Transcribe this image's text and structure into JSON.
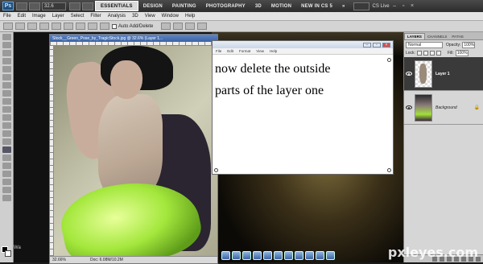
{
  "appbar": {
    "logo": "Ps",
    "zoom": "32.6",
    "workspaces": [
      "ESSENTIALS",
      "DESIGN",
      "PAINTING",
      "PHOTOGRAPHY",
      "3D",
      "MOTION",
      "NEW IN CS 5"
    ],
    "active_workspace": "ESSENTIALS",
    "cs_live": "CS Live"
  },
  "menubar": {
    "items": [
      "File",
      "Edit",
      "Image",
      "Layer",
      "Select",
      "Filter",
      "Analysis",
      "3D",
      "View",
      "Window",
      "Help"
    ]
  },
  "options": {
    "auto_add_delete": "Auto Add/Delete"
  },
  "document": {
    "tab_title": "Stock__Green_Pose_by_TragicStock.jpg @ 32.6% (Layer 1...",
    "zoom_status": "32.66%",
    "doc_status": "Doc: 6.08M/10.2M"
  },
  "notepad": {
    "menus": [
      "File",
      "Edit",
      "Format",
      "View",
      "Help"
    ],
    "line1": "now delete the outside",
    "line2": "parts of the layer one"
  },
  "layers_panel": {
    "tabs": [
      "LAYERS",
      "CHANNELS",
      "PATHS"
    ],
    "active_tab": "LAYERS",
    "blend_mode": "Normal",
    "opacity_label": "Opacity:",
    "opacity_value": "100%",
    "lock_label": "Lock:",
    "fill_label": "Fill:",
    "fill_value": "100%",
    "layers": [
      {
        "name": "Layer 1",
        "selected": true
      },
      {
        "name": "Background",
        "selected": false
      }
    ]
  },
  "watermark": {
    "left_text": "Wa",
    "site": "pxleyes.com"
  },
  "colors": {
    "active_layer_bg": "#3a3a3a",
    "notepad_bg": "#ffffff",
    "appbar_bg": "#2c2c2c",
    "green_fabric": "#a3e73c"
  }
}
